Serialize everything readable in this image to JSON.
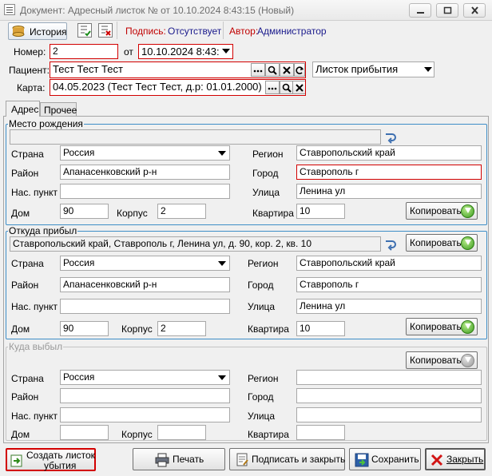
{
  "window": {
    "title": "Документ: Адресный листок №  от 10.10.2024 8:43:15 (Новый)"
  },
  "toolbar": {
    "history_label": "История",
    "sign_label": "Подпись:",
    "sign_value": "Отсутствует",
    "author_label": "Автор:",
    "author_value": "Администратор"
  },
  "header": {
    "number_label": "Номер:",
    "number_value": "2",
    "date_label": "от",
    "date_value": "10.10.2024 8:43:",
    "patient_label": "Пациент:",
    "patient_value": "Тест Тест Тест",
    "doc_type": "Листок прибытия",
    "card_label": "Карта:",
    "card_value": "04.05.2023 (Тест Тест Тест, д.р: 01.01.2000)"
  },
  "tabs": [
    {
      "label": "Адрес"
    },
    {
      "label": "Прочее"
    }
  ],
  "birth": {
    "title": "Место рождения",
    "summary": "",
    "country_label": "Страна",
    "country": "Россия",
    "region_label": "Регион",
    "region": "Ставропольский край",
    "district_label": "Район",
    "district": "Апанасенковский р-н",
    "city_label": "Город",
    "city": "Ставрополь г",
    "settlement_label": "Нас. пункт",
    "settlement": "",
    "street_label": "Улица",
    "street": "Ленина ул",
    "house_label": "Дом",
    "house": "90",
    "building_label": "Корпус",
    "building": "2",
    "flat_label": "Квартира",
    "flat": "10",
    "copy_label": "Копировать"
  },
  "arrived": {
    "title": "Откуда прибыл",
    "summary": "Ставропольский край, Ставрополь г, Ленина ул, д. 90, кор. 2, кв. 10",
    "country_label": "Страна",
    "country": "Россия",
    "region_label": "Регион",
    "region": "Ставропольский край",
    "district_label": "Район",
    "district": "Апанасенковский р-н",
    "city_label": "Город",
    "city": "Ставрополь г",
    "settlement_label": "Нас. пункт",
    "settlement": "",
    "street_label": "Улица",
    "street": "Ленина ул",
    "house_label": "Дом",
    "house": "90",
    "building_label": "Корпус",
    "building": "2",
    "flat_label": "Квартира",
    "flat": "10",
    "copy_label": "Копировать",
    "copy_label2": "Копировать"
  },
  "departed": {
    "title": "Куда выбыл",
    "country_label": "Страна",
    "country": "Россия",
    "region_label": "Регион",
    "region": "",
    "district_label": "Район",
    "district": "",
    "city_label": "Город",
    "city": "",
    "settlement_label": "Нас. пункт",
    "settlement": "",
    "street_label": "Улица",
    "street": "",
    "house_label": "Дом",
    "house": "",
    "building_label": "Корпус",
    "building": "",
    "flat_label": "Квартира",
    "flat": "",
    "copy_label": "Копировать"
  },
  "footer": {
    "create_line1": "Создать листок",
    "create_line2": "убытия",
    "print_label": "Печать",
    "sign_close_label": "Подписать и закрыть",
    "save_label": "Сохранить",
    "close_label": "Закрыть"
  },
  "colors": {
    "accent": "#3e8ec7",
    "error": "#d20000",
    "sign_value": "#c00000",
    "author_value": "#1a1a8c"
  }
}
